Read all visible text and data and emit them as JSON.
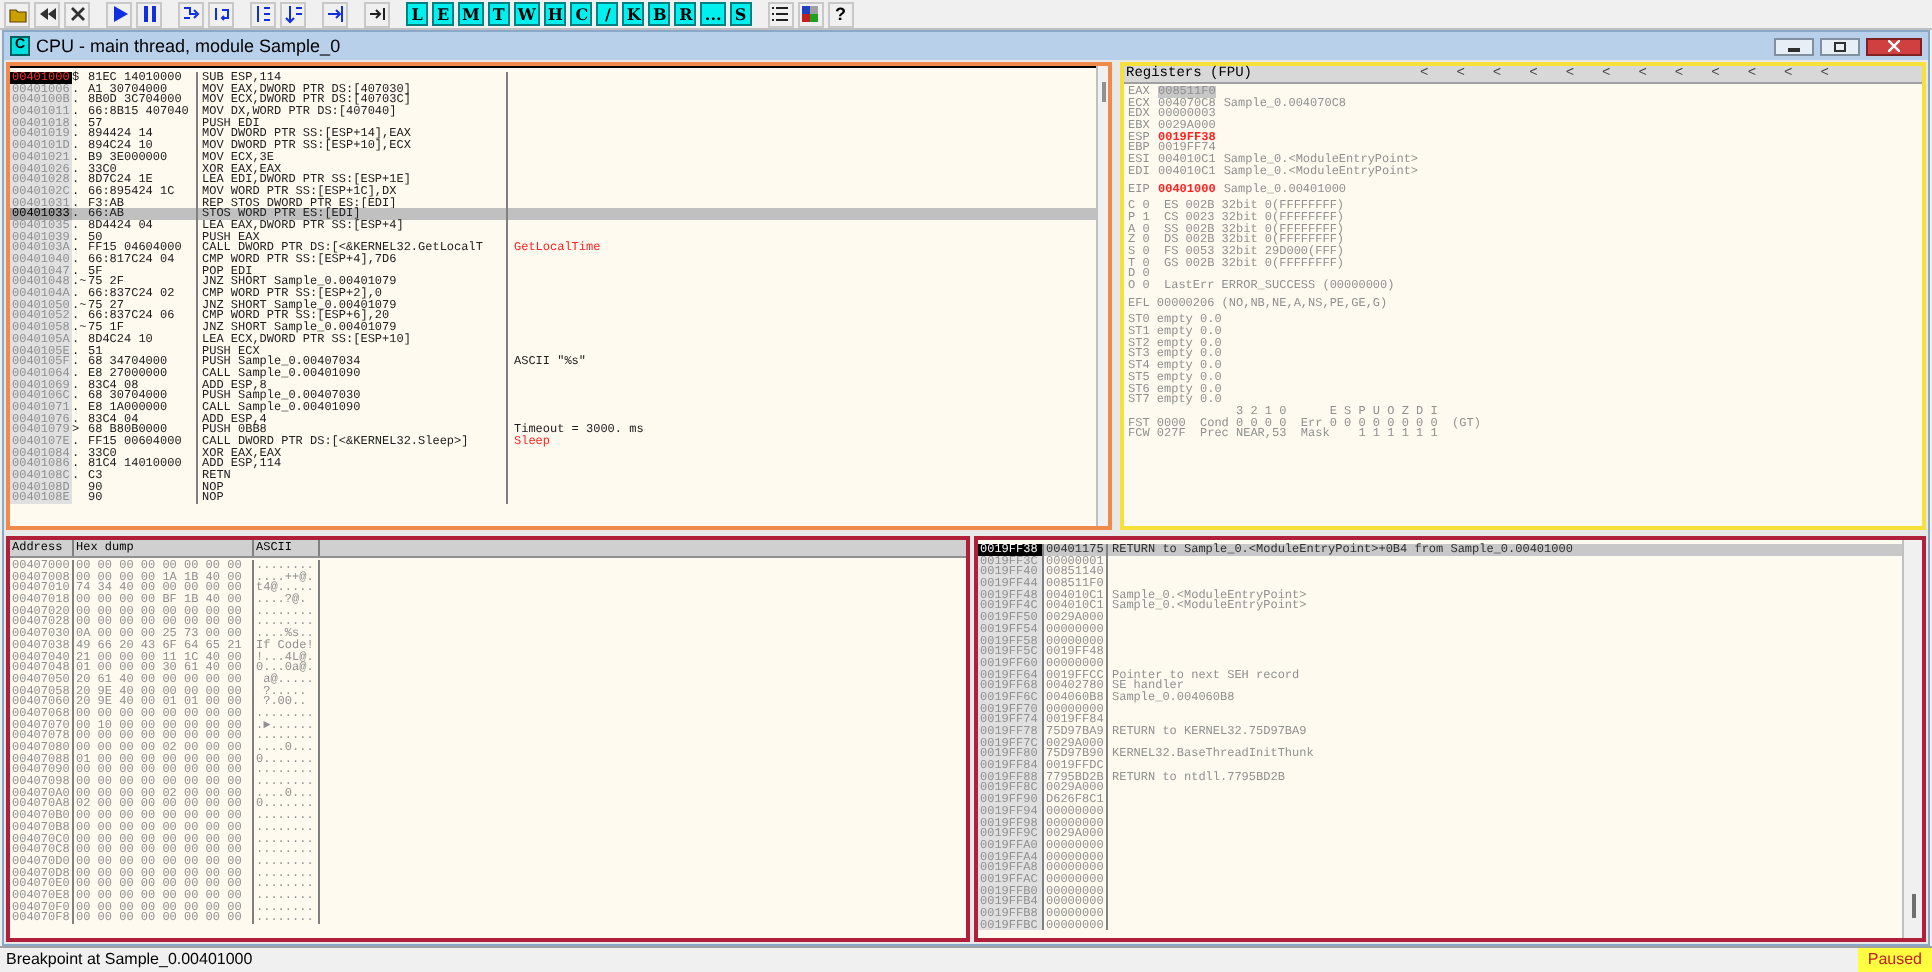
{
  "toolbar": {
    "letter_buttons": [
      "L",
      "E",
      "M",
      "T",
      "W",
      "H",
      "C",
      "/",
      "K",
      "B",
      "R",
      "...",
      "S"
    ],
    "help": "?"
  },
  "window": {
    "icon_letter": "C",
    "title": "CPU - main thread, module Sample_0"
  },
  "disassembly": {
    "rows": [
      {
        "address": "00401000",
        "prefix": "$",
        "hex": "81EC 14010000",
        "instruction": "SUB ESP,114",
        "is_eip": true,
        "selected": false
      },
      {
        "address": "00401006",
        "prefix": ".",
        "hex": "A1 30704000",
        "instruction": "MOV EAX,DWORD PTR DS:[407030]",
        "is_eip": false,
        "selected": false
      },
      {
        "address": "0040100B",
        "prefix": ".",
        "hex": "8B0D 3C704000",
        "instruction": "MOV ECX,DWORD PTR DS:[40703C]",
        "is_eip": false,
        "selected": false
      },
      {
        "address": "00401011",
        "prefix": ".",
        "hex": "66:8B15 407040",
        "instruction": "MOV DX,WORD PTR DS:[407040]",
        "is_eip": false,
        "selected": false
      },
      {
        "address": "00401018",
        "prefix": ".",
        "hex": "57",
        "instruction": "PUSH EDI",
        "is_eip": false,
        "selected": false
      },
      {
        "address": "00401019",
        "prefix": ".",
        "hex": "894424 14",
        "instruction": "MOV DWORD PTR SS:[ESP+14],EAX",
        "is_eip": false,
        "selected": false
      },
      {
        "address": "0040101D",
        "prefix": ".",
        "hex": "894C24 10",
        "instruction": "MOV DWORD PTR SS:[ESP+10],ECX",
        "is_eip": false,
        "selected": false
      },
      {
        "address": "00401021",
        "prefix": ".",
        "hex": "B9 3E000000",
        "instruction": "MOV ECX,3E",
        "is_eip": false,
        "selected": false
      },
      {
        "address": "00401026",
        "prefix": ".",
        "hex": "33C0",
        "instruction": "XOR EAX,EAX",
        "is_eip": false,
        "selected": false
      },
      {
        "address": "00401028",
        "prefix": ".",
        "hex": "8D7C24 1E",
        "instruction": "LEA EDI,DWORD PTR SS:[ESP+1E]",
        "is_eip": false,
        "selected": false
      },
      {
        "address": "0040102C",
        "prefix": ".",
        "hex": "66:895424 1C",
        "instruction": "MOV WORD PTR SS:[ESP+1C],DX",
        "is_eip": false,
        "selected": false
      },
      {
        "address": "00401031",
        "prefix": ".",
        "hex": "F3:AB",
        "instruction": "REP STOS DWORD PTR ES:[EDI]",
        "is_eip": false,
        "selected": false
      },
      {
        "address": "00401033",
        "prefix": ".",
        "hex": "66:AB",
        "instruction": "STOS WORD PTR ES:[EDI]",
        "is_eip": false,
        "selected": true
      },
      {
        "address": "00401035",
        "prefix": ".",
        "hex": "8D4424 04",
        "instruction": "LEA EAX,DWORD PTR SS:[ESP+4]",
        "is_eip": false,
        "selected": false
      },
      {
        "address": "00401039",
        "prefix": ".",
        "hex": "50",
        "instruction": "PUSH EAX",
        "is_eip": false,
        "selected": false
      },
      {
        "address": "0040103A",
        "prefix": ".",
        "hex": "FF15 04604000",
        "instruction": "CALL DWORD PTR DS:[<&KERNEL32.GetLocalT",
        "comment": "GetLocalTime",
        "comment_is_api": true,
        "is_eip": false,
        "selected": false
      },
      {
        "address": "00401040",
        "prefix": ".",
        "hex": "66:817C24 04",
        "instruction": "CMP WORD PTR SS:[ESP+4],7D6",
        "is_eip": false,
        "selected": false
      },
      {
        "address": "00401047",
        "prefix": ".",
        "hex": "5F",
        "instruction": "POP EDI",
        "is_eip": false,
        "selected": false
      },
      {
        "address": "00401048",
        "prefix": ".~",
        "hex": "75 2F",
        "instruction": "JNZ SHORT Sample_0.00401079",
        "is_eip": false,
        "selected": false
      },
      {
        "address": "0040104A",
        "prefix": ".",
        "hex": "66:837C24 02",
        "instruction": "CMP WORD PTR SS:[ESP+2],0",
        "is_eip": false,
        "selected": false
      },
      {
        "address": "00401050",
        "prefix": ".~",
        "hex": "75 27",
        "instruction": "JNZ SHORT Sample_0.00401079",
        "is_eip": false,
        "selected": false
      },
      {
        "address": "00401052",
        "prefix": ".",
        "hex": "66:837C24 06",
        "instruction": "CMP WORD PTR SS:[ESP+6],20",
        "is_eip": false,
        "selected": false
      },
      {
        "address": "00401058",
        "prefix": ".~",
        "hex": "75 1F",
        "instruction": "JNZ SHORT Sample_0.00401079",
        "is_eip": false,
        "selected": false
      },
      {
        "address": "0040105A",
        "prefix": ".",
        "hex": "8D4C24 10",
        "instruction": "LEA ECX,DWORD PTR SS:[ESP+10]",
        "is_eip": false,
        "selected": false
      },
      {
        "address": "0040105E",
        "prefix": ".",
        "hex": "51",
        "instruction": "PUSH ECX",
        "is_eip": false,
        "selected": false
      },
      {
        "address": "0040105F",
        "prefix": ".",
        "hex": "68 34704000",
        "instruction": "PUSH Sample_0.00407034",
        "comment": "ASCII \"%s\"",
        "comment_is_api": false,
        "is_eip": false,
        "selected": false
      },
      {
        "address": "00401064",
        "prefix": ".",
        "hex": "E8 27000000",
        "instruction": "CALL Sample_0.00401090",
        "is_eip": false,
        "selected": false
      },
      {
        "address": "00401069",
        "prefix": ".",
        "hex": "83C4 08",
        "instruction": "ADD ESP,8",
        "is_eip": false,
        "selected": false
      },
      {
        "address": "0040106C",
        "prefix": ".",
        "hex": "68 30704000",
        "instruction": "PUSH Sample_0.00407030",
        "is_eip": false,
        "selected": false
      },
      {
        "address": "00401071",
        "prefix": ".",
        "hex": "E8 1A000000",
        "instruction": "CALL Sample_0.00401090",
        "is_eip": false,
        "selected": false
      },
      {
        "address": "00401076",
        "prefix": ".",
        "hex": "83C4 04",
        "instruction": "ADD ESP,4",
        "is_eip": false,
        "selected": false
      },
      {
        "address": "00401079",
        "prefix": ">",
        "hex": "68 B80B0000",
        "instruction": "PUSH 0BB8",
        "comment": "Timeout = 3000. ms",
        "comment_is_api": false,
        "is_eip": false,
        "selected": false
      },
      {
        "address": "0040107E",
        "prefix": ".",
        "hex": "FF15 00604000",
        "instruction": "CALL DWORD PTR DS:[<&KERNEL32.Sleep>]",
        "comment": "Sleep",
        "comment_is_api": true,
        "is_eip": false,
        "selected": false
      },
      {
        "address": "00401084",
        "prefix": ".",
        "hex": "33C0",
        "instruction": "XOR EAX,EAX",
        "is_eip": false,
        "selected": false
      },
      {
        "address": "00401086",
        "prefix": ".",
        "hex": "81C4 14010000",
        "instruction": "ADD ESP,114",
        "is_eip": false,
        "selected": false
      },
      {
        "address": "0040108C",
        "prefix": ".",
        "hex": "C3",
        "instruction": "RETN",
        "is_eip": false,
        "selected": false
      },
      {
        "address": "0040108D",
        "hex": "90",
        "instruction": "NOP",
        "is_eip": false,
        "selected": false
      },
      {
        "address": "0040108E",
        "hex": "90",
        "instruction": "NOP",
        "is_eip": false,
        "selected": false
      }
    ]
  },
  "registers": {
    "title": "Registers (FPU)",
    "arrows": [
      "<",
      "<",
      "<",
      "<",
      "<",
      "<",
      "<",
      "<",
      "<",
      "<",
      "<",
      "<"
    ],
    "general": [
      {
        "name": "EAX",
        "value": "008511F0",
        "changed": false,
        "selected": true
      },
      {
        "name": "ECX",
        "value": "004070C8",
        "comment": "Sample_0.004070C8",
        "changed": false,
        "selected": false
      },
      {
        "name": "EDX",
        "value": "00000003",
        "changed": false,
        "selected": false
      },
      {
        "name": "EBX",
        "value": "0029A000",
        "changed": false,
        "selected": false
      },
      {
        "name": "ESP",
        "value": "0019FF38",
        "changed": true,
        "selected": false
      },
      {
        "name": "EBP",
        "value": "0019FF74",
        "changed": false,
        "selected": false
      },
      {
        "name": "ESI",
        "value": "004010C1",
        "comment": "Sample_0.<ModuleEntryPoint>",
        "changed": false,
        "selected": false
      },
      {
        "name": "EDI",
        "value": "004010C1",
        "comment": "Sample_0.<ModuleEntryPoint>",
        "changed": false,
        "selected": false
      }
    ],
    "eip": {
      "name": "EIP",
      "value": "00401000",
      "comment": "Sample_0.00401000",
      "changed": true,
      "selected": false
    },
    "flag_lines": [
      "C 0  ES 002B 32bit 0(FFFFFFFF)",
      "P 1  CS 0023 32bit 0(FFFFFFFF)",
      "A 0  SS 002B 32bit 0(FFFFFFFF)",
      "Z 0  DS 002B 32bit 0(FFFFFFFF)",
      "S 0  FS 0053 32bit 29D000(FFF)",
      "T 0  GS 002B 32bit 0(FFFFFFFF)",
      "D 0",
      "O 0  LastErr ERROR_SUCCESS (00000000)"
    ],
    "efl": "EFL 00000206 (NO,NB,NE,A,NS,PE,GE,G)",
    "fpu_lines": [
      "ST0 empty 0.0",
      "ST1 empty 0.0",
      "ST2 empty 0.0",
      "ST3 empty 0.0",
      "ST4 empty 0.0",
      "ST5 empty 0.0",
      "ST6 empty 0.0",
      "ST7 empty 0.0"
    ],
    "status_lines": [
      "               3 2 1 0      E S P U O Z D I",
      "FST 0000  Cond 0 0 0 0  Err 0 0 0 0 0 0 0 0  (GT)",
      "FCW 027F  Prec NEAR,53  Mask    1 1 1 1 1 1"
    ]
  },
  "dump": {
    "columns": [
      "Address",
      "Hex dump",
      "ASCII"
    ],
    "rows": [
      {
        "address": "00407000",
        "hex": "00 00 00 00 00 00 00 00",
        "ascii": "........"
      },
      {
        "address": "00407008",
        "hex": "00 00 00 00 1A 1B 40 00",
        "ascii": "....++@."
      },
      {
        "address": "00407010",
        "hex": "74 34 40 00 00 00 00 00",
        "ascii": "t4@....."
      },
      {
        "address": "00407018",
        "hex": "00 00 00 00 BF 1B 40 00",
        "ascii": "....?@."
      },
      {
        "address": "00407020",
        "hex": "00 00 00 00 00 00 00 00",
        "ascii": "........"
      },
      {
        "address": "00407028",
        "hex": "00 00 00 00 00 00 00 00",
        "ascii": "........"
      },
      {
        "address": "00407030",
        "hex": "0A 00 00 00 25 73 00 00",
        "ascii": "....%s.."
      },
      {
        "address": "00407038",
        "hex": "49 66 20 43 6F 64 65 21",
        "ascii": "If Code!"
      },
      {
        "address": "00407040",
        "hex": "21 00 00 00 11 1C 40 00",
        "ascii": "!...4L@."
      },
      {
        "address": "00407048",
        "hex": "01 00 00 00 30 61 40 00",
        "ascii": "0...0a@."
      },
      {
        "address": "00407050",
        "hex": "20 61 40 00 00 00 00 00",
        "ascii": " a@....."
      },
      {
        "address": "00407058",
        "hex": "20 9E 40 00 00 00 00 00",
        "ascii": " ?....."
      },
      {
        "address": "00407060",
        "hex": "20 9E 40 00 01 01 00 00",
        "ascii": " ?.00.."
      },
      {
        "address": "00407068",
        "hex": "00 00 00 00 00 00 00 00",
        "ascii": "........"
      },
      {
        "address": "00407070",
        "hex": "00 10 00 00 00 00 00 00",
        "ascii": ".►......"
      },
      {
        "address": "00407078",
        "hex": "00 00 00 00 00 00 00 00",
        "ascii": "........"
      },
      {
        "address": "00407080",
        "hex": "00 00 00 00 02 00 00 00",
        "ascii": "....0..."
      },
      {
        "address": "00407088",
        "hex": "01 00 00 00 00 00 00 00",
        "ascii": "0......."
      },
      {
        "address": "00407090",
        "hex": "00 00 00 00 00 00 00 00",
        "ascii": "........"
      },
      {
        "address": "00407098",
        "hex": "00 00 00 00 00 00 00 00",
        "ascii": "........"
      },
      {
        "address": "004070A0",
        "hex": "00 00 00 00 02 00 00 00",
        "ascii": "....0..."
      },
      {
        "address": "004070A8",
        "hex": "02 00 00 00 00 00 00 00",
        "ascii": "0......."
      },
      {
        "address": "004070B0",
        "hex": "00 00 00 00 00 00 00 00",
        "ascii": "........"
      },
      {
        "address": "004070B8",
        "hex": "00 00 00 00 00 00 00 00",
        "ascii": "........"
      },
      {
        "address": "004070C0",
        "hex": "00 00 00 00 00 00 00 00",
        "ascii": "........"
      },
      {
        "address": "004070C8",
        "hex": "00 00 00 00 00 00 00 00",
        "ascii": "........"
      },
      {
        "address": "004070D0",
        "hex": "00 00 00 00 00 00 00 00",
        "ascii": "........"
      },
      {
        "address": "004070D8",
        "hex": "00 00 00 00 00 00 00 00",
        "ascii": "........"
      },
      {
        "address": "004070E0",
        "hex": "00 00 00 00 00 00 00 00",
        "ascii": "........"
      },
      {
        "address": "004070E8",
        "hex": "00 00 00 00 00 00 00 00",
        "ascii": "........"
      },
      {
        "address": "004070F0",
        "hex": "00 00 00 00 00 00 00 00",
        "ascii": "........"
      },
      {
        "address": "004070F8",
        "hex": "00 00 00 00 00 00 00 00",
        "ascii": "........"
      }
    ]
  },
  "stack": {
    "rows": [
      {
        "address": "0019FF38",
        "value": "00401175",
        "comment": "RETURN to Sample_0.<ModuleEntryPoint>+0B4 from Sample_0.00401000",
        "selected": true
      },
      {
        "address": "0019FF3C",
        "value": "00000001",
        "selected": false
      },
      {
        "address": "0019FF40",
        "value": "00851140",
        "selected": false
      },
      {
        "address": "0019FF44",
        "value": "008511F0",
        "selected": false
      },
      {
        "address": "0019FF48",
        "value": "004010C1",
        "comment": "Sample_0.<ModuleEntryPoint>",
        "selected": false
      },
      {
        "address": "0019FF4C",
        "value": "004010C1",
        "comment": "Sample_0.<ModuleEntryPoint>",
        "selected": false
      },
      {
        "address": "0019FF50",
        "value": "0029A000",
        "selected": false
      },
      {
        "address": "0019FF54",
        "value": "00000000",
        "selected": false
      },
      {
        "address": "0019FF58",
        "value": "00000000",
        "selected": false
      },
      {
        "address": "0019FF5C",
        "value": "0019FF48",
        "selected": false
      },
      {
        "address": "0019FF60",
        "value": "00000000",
        "selected": false
      },
      {
        "address": "0019FF64",
        "value": "0019FFCC",
        "comment": "Pointer to next SEH record",
        "selected": false
      },
      {
        "address": "0019FF68",
        "value": "00402780",
        "comment": "SE handler",
        "selected": false
      },
      {
        "address": "0019FF6C",
        "value": "004060B8",
        "comment": "Sample_0.004060B8",
        "selected": false
      },
      {
        "address": "0019FF70",
        "value": "00000000",
        "selected": false
      },
      {
        "address": "0019FF74",
        "value": "0019FF84",
        "selected": false
      },
      {
        "address": "0019FF78",
        "value": "75D97BA9",
        "comment": "RETURN to KERNEL32.75D97BA9",
        "selected": false
      },
      {
        "address": "0019FF7C",
        "value": "0029A000",
        "selected": false
      },
      {
        "address": "0019FF80",
        "value": "75D97B90",
        "comment": "KERNEL32.BaseThreadInitThunk",
        "selected": false
      },
      {
        "address": "0019FF84",
        "value": "0019FFDC",
        "selected": false
      },
      {
        "address": "0019FF88",
        "value": "7795BD2B",
        "comment": "RETURN to ntdll.7795BD2B",
        "selected": false
      },
      {
        "address": "0019FF8C",
        "value": "0029A000",
        "selected": false
      },
      {
        "address": "0019FF90",
        "value": "D626F8C1",
        "selected": false
      },
      {
        "address": "0019FF94",
        "value": "00000000",
        "selected": false
      },
      {
        "address": "0019FF98",
        "value": "00000000",
        "selected": false
      },
      {
        "address": "0019FF9C",
        "value": "0029A000",
        "selected": false
      },
      {
        "address": "0019FFA0",
        "value": "00000000",
        "selected": false
      },
      {
        "address": "0019FFA4",
        "value": "00000000",
        "selected": false
      },
      {
        "address": "0019FFA8",
        "value": "00000000",
        "selected": false
      },
      {
        "address": "0019FFAC",
        "value": "00000000",
        "selected": false
      },
      {
        "address": "0019FFB0",
        "value": "00000000",
        "selected": false
      },
      {
        "address": "0019FFB4",
        "value": "00000000",
        "selected": false
      },
      {
        "address": "0019FFB8",
        "value": "00000000",
        "selected": false
      },
      {
        "address": "0019FFBC",
        "value": "00000000",
        "selected": false
      }
    ]
  },
  "status_bar": {
    "message": "Breakpoint at Sample_0.00401000",
    "state": "Paused"
  }
}
